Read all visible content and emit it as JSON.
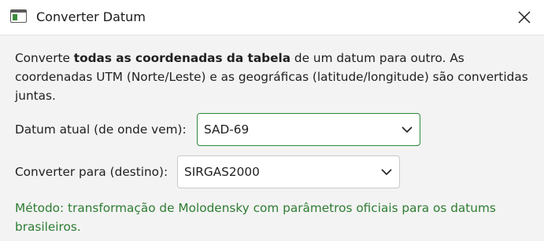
{
  "window": {
    "title": "Converter Datum"
  },
  "intro": {
    "prefix": "Converte ",
    "bold": "todas as coordenadas da tabela",
    "suffix": " de um datum para outro. As coordenadas UTM (Norte/Leste) e as geográficas (latitude/longitude) são convertidas juntas."
  },
  "form": {
    "current_datum": {
      "label": "Datum atual (de onde vem):",
      "value": "SAD-69"
    },
    "target_datum": {
      "label": "Converter para (destino):",
      "value": "SIRGAS2000"
    }
  },
  "method_note": "Método: transformação de Molodensky com parâmetros oficiais para os datums brasileiros.",
  "colors": {
    "focus_border": "#2e8b3a",
    "note_text": "#2e7d32"
  },
  "icons": {
    "app": "window-app-icon",
    "close": "close-icon",
    "dropdown": "chevron-down-icon"
  }
}
